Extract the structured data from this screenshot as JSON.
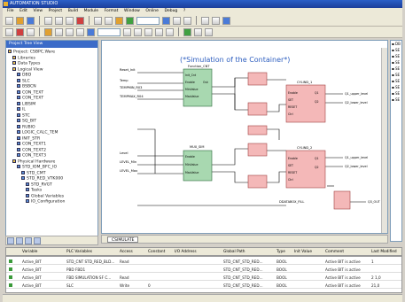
{
  "window": {
    "title": "AUTOMATION STUDIO"
  },
  "menu": [
    "File",
    "Edit",
    "View",
    "Project",
    "Build",
    "Module",
    "Format",
    "Window",
    "Online",
    "Debug",
    "?"
  ],
  "left_panel": {
    "title": "Project Tree View",
    "tree": [
      {
        "label": "Project: CSBPC.Ware",
        "depth": 0
      },
      {
        "label": "Libraries",
        "depth": 1
      },
      {
        "label": "Data Types",
        "depth": 1
      },
      {
        "label": "Logical View",
        "depth": 1
      },
      {
        "label": "DBD",
        "depth": 2
      },
      {
        "label": "SLC",
        "depth": 2
      },
      {
        "label": "BSBCN",
        "depth": 2
      },
      {
        "label": "CON_TEXT",
        "depth": 2
      },
      {
        "label": "CON_TEXT",
        "depth": 2
      },
      {
        "label": "LIBSIM",
        "depth": 2
      },
      {
        "label": "IL",
        "depth": 2
      },
      {
        "label": "STC",
        "depth": 2
      },
      {
        "label": "SQ_BIT",
        "depth": 2
      },
      {
        "label": "RUBIO",
        "depth": 2
      },
      {
        "label": "LOGIC_CALC_TEM",
        "depth": 2
      },
      {
        "label": "INIT_STR",
        "depth": 2
      },
      {
        "label": "CON_TEXT1",
        "depth": 2
      },
      {
        "label": "CON_TEXT2",
        "depth": 2
      },
      {
        "label": "CON_TEXT3",
        "depth": 2
      },
      {
        "label": "Physical Hardware",
        "depth": 1
      },
      {
        "label": "STD_IOM_BFC_IO",
        "depth": 2
      },
      {
        "label": "STD_CMT",
        "depth": 3
      },
      {
        "label": "STD_RED_VTK000",
        "depth": 3
      },
      {
        "label": "STD_RVGT",
        "depth": 4
      },
      {
        "label": "Tasks",
        "depth": 4
      },
      {
        "label": "Global Variables",
        "depth": 4
      },
      {
        "label": "IO_Configuration",
        "depth": 4
      }
    ]
  },
  "editor": {
    "title": "(*Simulation of the Container*)",
    "tab": "CSIMULATE",
    "fb1": {
      "title": "Function_CNT",
      "inputs": [
        "Init_Cnt",
        "Enable",
        "MinValue",
        "MaxValue"
      ],
      "outputs": [
        "Out",
        "Q"
      ]
    },
    "fb2": {
      "title": "MUX_SIM",
      "inputs": [
        "Enable",
        "MinValue",
        "MaxValue"
      ],
      "outputs": [
        "Out"
      ]
    },
    "fb3": {
      "title": "CYLIND_1",
      "inputs": [
        "Enable",
        "SET",
        "RESET",
        "Ctrl"
      ],
      "outputs": [
        "Q1",
        "Q2"
      ]
    },
    "fb4": {
      "title": "CYLIND_2",
      "inputs": [
        "Enable",
        "SET",
        "RESET",
        "Ctrl"
      ],
      "outputs": [
        "Q1",
        "Q2"
      ]
    },
    "in_vars": [
      "Reset_Init",
      "Temp",
      "TEMPMIN_R03",
      "TEMPMAX_R04",
      "Level",
      "LEVEL_Min",
      "LEVEL_Max"
    ],
    "out_vars": [
      "Q1_upper_level",
      "Q2_lower_level",
      "Q1_upper_level",
      "Q2_lower_level",
      "Q3_OUT"
    ],
    "small_gates": [
      "AND",
      "OR",
      "AND",
      "OR",
      "AND",
      "OR",
      "MOVE"
    ],
    "bottom_var": "DDATABOX_FILL"
  },
  "table": {
    "headers": [
      "Variable",
      "PLC Variables",
      "Access",
      "Constant",
      "I/O Address",
      "Global Path",
      "Type",
      "Init Value",
      "Comment",
      "Last Modified"
    ],
    "rows": [
      [
        "Active_BIT",
        "STD_CNT STD_RED_BLD...",
        "Read",
        "",
        "",
        "STD_CNT_STD_RED...",
        "BOOL",
        "",
        "Active BIT is active",
        "1"
      ],
      [
        "Active_BIT",
        "PBD FBD1",
        "",
        "",
        "",
        "STD_CNT_STD_RED...",
        "BOOL",
        "",
        "Active BIT is active",
        ""
      ],
      [
        "Active_BIT",
        "FBD SIMULATION SF C...",
        "Read",
        "",
        "",
        "STD_CNT_STD_RED...",
        "BOOL",
        "",
        "Active BIT is active",
        "2 1,0"
      ],
      [
        "Active_BIT",
        "SLC",
        "Write",
        "0",
        "",
        "STD_CNT_STD_RED...",
        "BOOL",
        "",
        "Active BIT is active",
        "21,0"
      ]
    ]
  }
}
